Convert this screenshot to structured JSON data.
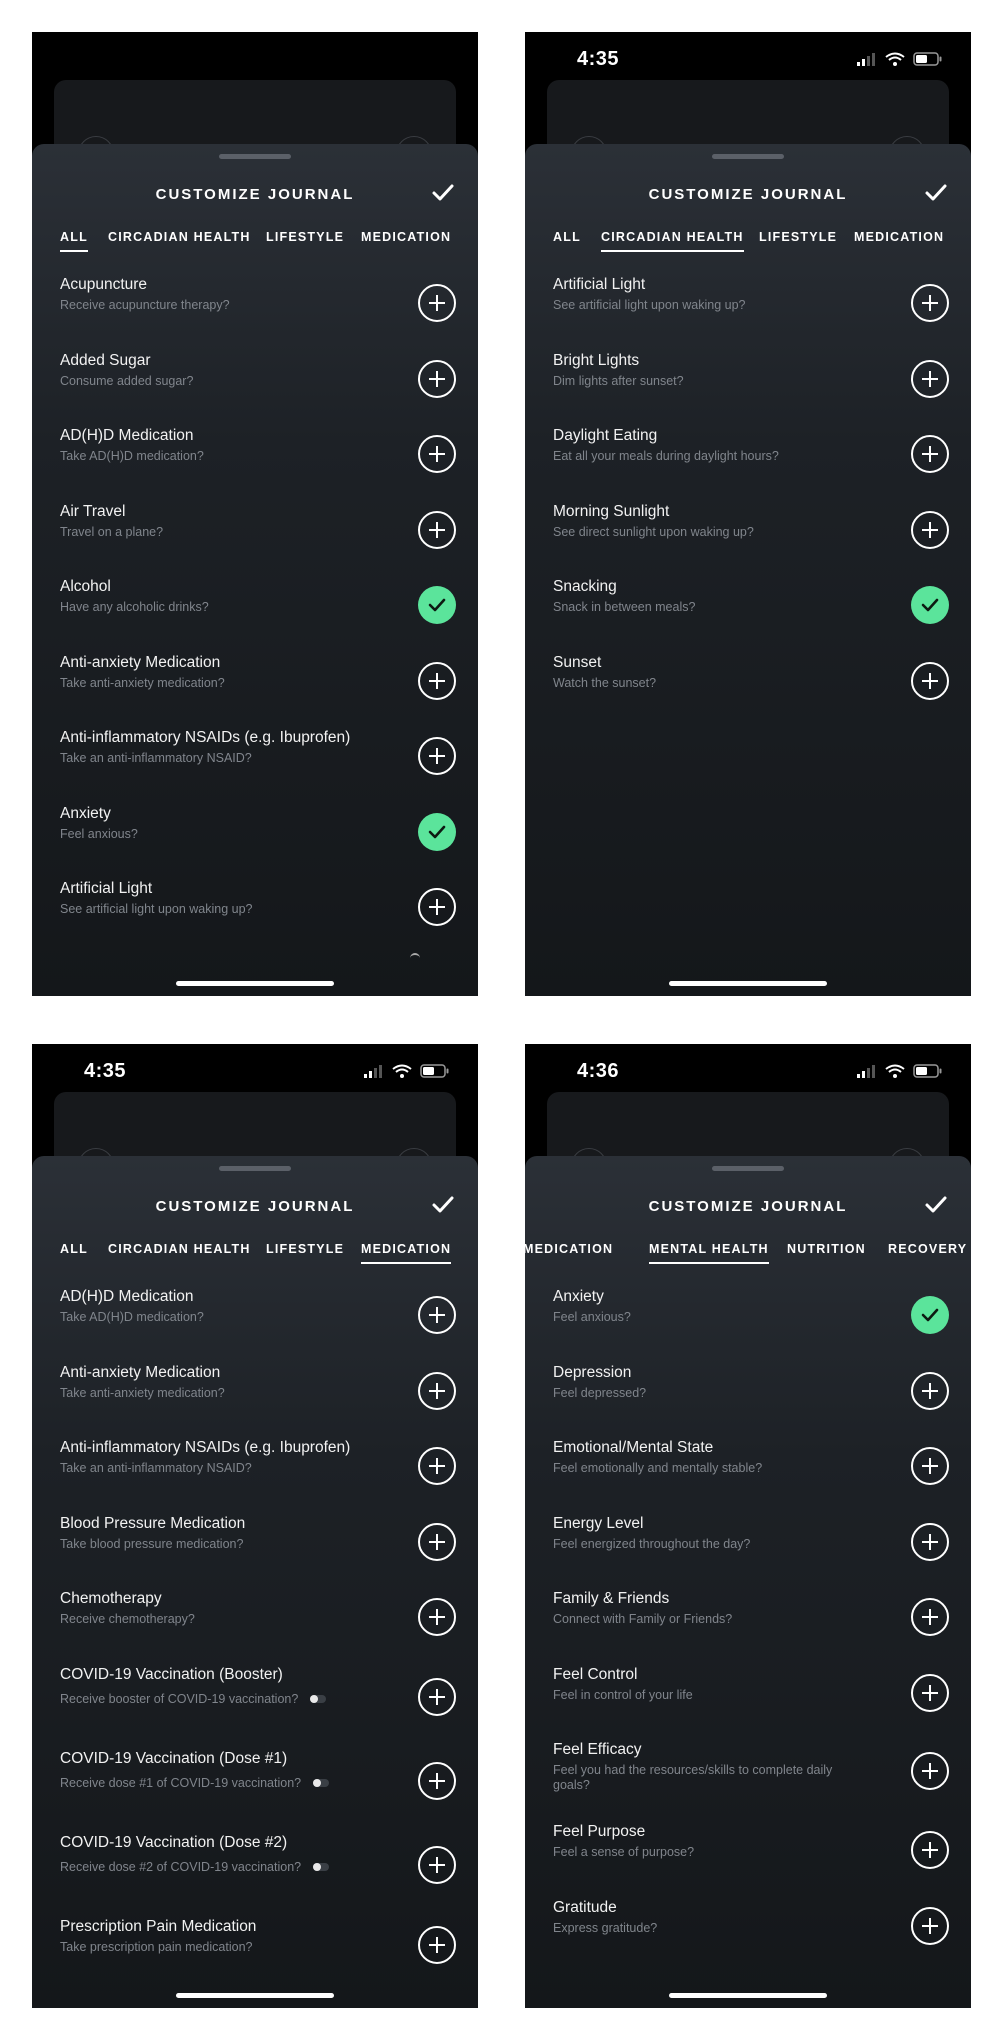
{
  "panels": [
    {
      "status_time": "",
      "title": "CUSTOMIZE JOURNAL",
      "tabs": [
        "ALL",
        "CIRCADIAN HEALTH",
        "LIFESTYLE",
        "MEDICATION"
      ],
      "active_tab": "ALL",
      "items": [
        {
          "title": "Acupuncture",
          "subtitle": "Receive acupuncture therapy?",
          "state": "add"
        },
        {
          "title": "Added Sugar",
          "subtitle": "Consume added sugar?",
          "state": "add"
        },
        {
          "title": "AD(H)D Medication",
          "subtitle": "Take AD(H)D medication?",
          "state": "add"
        },
        {
          "title": "Air Travel",
          "subtitle": "Travel on a plane?",
          "state": "add"
        },
        {
          "title": "Alcohol",
          "subtitle": "Have any alcoholic drinks?",
          "state": "selected"
        },
        {
          "title": "Anti-anxiety Medication",
          "subtitle": "Take anti-anxiety medication?",
          "state": "add"
        },
        {
          "title": "Anti-inflammatory NSAIDs (e.g. Ibuprofen)",
          "subtitle": "Take an anti-inflammatory NSAID?",
          "state": "add"
        },
        {
          "title": "Anxiety",
          "subtitle": "Feel anxious?",
          "state": "selected"
        },
        {
          "title": "Artificial Light",
          "subtitle": "See artificial light upon waking up?",
          "state": "add"
        }
      ]
    },
    {
      "status_time": "4:35",
      "title": "CUSTOMIZE JOURNAL",
      "tabs": [
        "ALL",
        "CIRCADIAN HEALTH",
        "LIFESTYLE",
        "MEDICATION"
      ],
      "active_tab": "CIRCADIAN HEALTH",
      "items": [
        {
          "title": "Artificial Light",
          "subtitle": "See artificial light upon waking up?",
          "state": "add"
        },
        {
          "title": "Bright Lights",
          "subtitle": "Dim lights after sunset?",
          "state": "add"
        },
        {
          "title": "Daylight Eating",
          "subtitle": "Eat all your meals during daylight hours?",
          "state": "add"
        },
        {
          "title": "Morning Sunlight",
          "subtitle": "See direct sunlight upon waking up?",
          "state": "add"
        },
        {
          "title": "Snacking",
          "subtitle": "Snack in between meals?",
          "state": "selected"
        },
        {
          "title": "Sunset",
          "subtitle": "Watch the sunset?",
          "state": "add"
        }
      ]
    },
    {
      "status_time": "4:35",
      "title": "CUSTOMIZE JOURNAL",
      "tabs": [
        "ALL",
        "CIRCADIAN HEALTH",
        "LIFESTYLE",
        "MEDICATION"
      ],
      "active_tab": "MEDICATION",
      "items": [
        {
          "title": "AD(H)D Medication",
          "subtitle": "Take AD(H)D medication?",
          "state": "add"
        },
        {
          "title": "Anti-anxiety Medication",
          "subtitle": "Take anti-anxiety medication?",
          "state": "add"
        },
        {
          "title": "Anti-inflammatory NSAIDs (e.g. Ibuprofen)",
          "subtitle": "Take an anti-inflammatory NSAID?",
          "state": "add"
        },
        {
          "title": "Blood Pressure Medication",
          "subtitle": "Take blood pressure medication?",
          "state": "add"
        },
        {
          "title": "Chemotherapy",
          "subtitle": "Receive chemotherapy?",
          "state": "add"
        },
        {
          "title": "COVID-19 Vaccination (Booster)",
          "subtitle": "Receive booster of COVID-19 vaccination?",
          "state": "add",
          "paged": true
        },
        {
          "title": "COVID-19 Vaccination (Dose #1)",
          "subtitle": "Receive dose #1 of COVID-19 vaccination?",
          "state": "add",
          "paged": true
        },
        {
          "title": "COVID-19 Vaccination (Dose #2)",
          "subtitle": "Receive dose #2 of COVID-19 vaccination?",
          "state": "add",
          "paged": true
        },
        {
          "title": "Prescription Pain Medication",
          "subtitle": "Take prescription pain medication?",
          "state": "add"
        }
      ]
    },
    {
      "status_time": "4:36",
      "title": "CUSTOMIZE JOURNAL",
      "tabs": [
        "MEDICATION",
        "MENTAL HEALTH",
        "NUTRITION",
        "RECOVERY"
      ],
      "active_tab": "MENTAL HEALTH",
      "items": [
        {
          "title": "Anxiety",
          "subtitle": "Feel anxious?",
          "state": "selected"
        },
        {
          "title": "Depression",
          "subtitle": "Feel depressed?",
          "state": "add"
        },
        {
          "title": "Emotional/Mental State",
          "subtitle": "Feel emotionally and mentally stable?",
          "state": "add"
        },
        {
          "title": "Energy Level",
          "subtitle": "Feel energized throughout the day?",
          "state": "add"
        },
        {
          "title": "Family & Friends",
          "subtitle": "Connect with Family or Friends?",
          "state": "add"
        },
        {
          "title": "Feel Control",
          "subtitle": "Feel in control of your life",
          "state": "add"
        },
        {
          "title": "Feel Efficacy",
          "subtitle": "Feel you had the resources/skills to complete daily goals?",
          "state": "add"
        },
        {
          "title": "Feel Purpose",
          "subtitle": "Feel a sense of purpose?",
          "state": "add"
        },
        {
          "title": "Gratitude",
          "subtitle": "Express gratitude?",
          "state": "add"
        }
      ]
    }
  ],
  "colors": {
    "selected": "#5be49b",
    "sheet_top": "#2b3037",
    "sheet_bottom": "#14171a"
  }
}
